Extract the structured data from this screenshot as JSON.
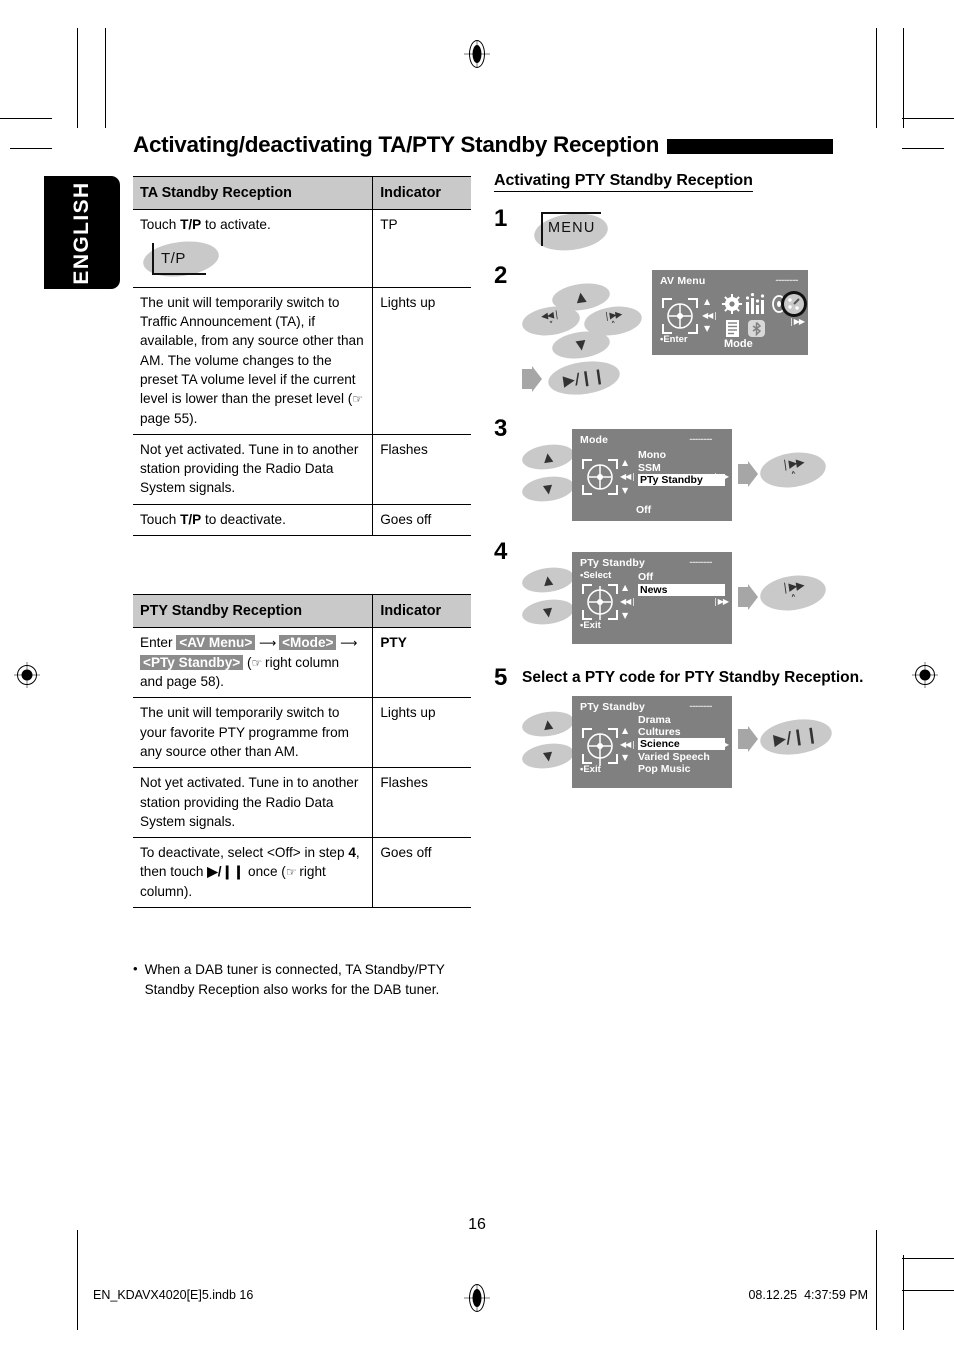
{
  "page": {
    "language_tab": "ENGLISH",
    "title": "Activating/deactivating TA/PTY Standby Reception",
    "page_number": "16"
  },
  "footer": {
    "file": "EN_KDAVX4020[E]5.indb   16",
    "date": "08.12.25",
    "time": "4:37:59 PM"
  },
  "ta_table": {
    "headers": [
      "TA Standby Reception",
      "Indicator"
    ],
    "rows": [
      {
        "desc": "Touch T/P to activate.",
        "button_label": "T/P",
        "indicator": "TP"
      },
      {
        "desc": "The unit will temporarily switch to Traffic Announcement (TA), if available, from any source other than AM. The volume changes to the preset TA volume level if the current level is lower than the preset level (☞ page 55).",
        "indicator": "Lights up"
      },
      {
        "desc": "Not yet activated. Tune in to another station providing the Radio Data System signals.",
        "indicator": "Flashes"
      },
      {
        "desc": "Touch T/P to deactivate.",
        "indicator": "Goes off"
      }
    ]
  },
  "pty_table": {
    "headers": [
      "PTY Standby Reception",
      "Indicator"
    ],
    "rows": [
      {
        "prefix": "Enter ",
        "tag1": "<AV Menu>",
        "tag2": "<Mode>",
        "tag3": "<PTy Standby>",
        "suffix": "(☞ right column and page 58).",
        "indicator": "PTY"
      },
      {
        "desc": "The unit will temporarily switch to your favorite PTY programme from any source other than AM.",
        "indicator": "Lights up"
      },
      {
        "desc": "Not yet activated. Tune in to another station providing the Radio Data System signals.",
        "indicator": "Flashes"
      },
      {
        "desc": "To deactivate, select <Off> in step 4, then touch ▶/❙❙ once (☞ right column).",
        "indicator": "Goes off"
      }
    ]
  },
  "note": {
    "bullet": "•",
    "text": "When a DAB tuner is connected, TA Standby/PTY Standby Reception also works for the DAB tuner."
  },
  "procedure": {
    "heading": "Activating PTY Standby Reception",
    "steps": [
      {
        "num": "1",
        "button": "MENU"
      },
      {
        "num": "2",
        "buttons": {
          "up": "▲",
          "down": "▼",
          "prev": "⏮",
          "next": "⏭",
          "play_pause": "▶/❙❙"
        },
        "lcd": {
          "title": "AV Menu",
          "dashes": "--------",
          "enter": "Enter",
          "mode": "Mode",
          "icons": [
            "gear-icon",
            "equalizer-icon",
            "disc-icon",
            "mode-dial-icon",
            "list-icon",
            "bluetooth-icon"
          ]
        }
      },
      {
        "num": "3",
        "lcd": {
          "title": "Mode",
          "dashes": "--------",
          "items": [
            "Mono",
            "SSM",
            "PTy Standby"
          ],
          "selected": "PTy Standby",
          "footer_item": "Off"
        },
        "next_button": "⏭"
      },
      {
        "num": "4",
        "lcd": {
          "title": "PTy Standby",
          "dashes": "--------",
          "select_label": "Select",
          "exit_label": "Exit",
          "items": [
            "Off",
            "News"
          ],
          "selected": "News"
        },
        "next_button": "⏭"
      },
      {
        "num": "5",
        "instruction": "Select a PTY code for PTY Standby Reception.",
        "lcd": {
          "title": "PTy Standby",
          "dashes": "--------",
          "exit_label": "Exit",
          "items": [
            "Drama",
            "Cultures",
            "Science",
            "Varied Speech",
            "Pop Music"
          ],
          "selected": "Science"
        },
        "play_button": "▶/❙❙"
      }
    ]
  },
  "colors": {
    "lcd_bg": "#808080",
    "table_header_bg": "#c9c9c9",
    "button_grey": "#c9c9c9",
    "tag_grey": "#8c8c8c"
  }
}
